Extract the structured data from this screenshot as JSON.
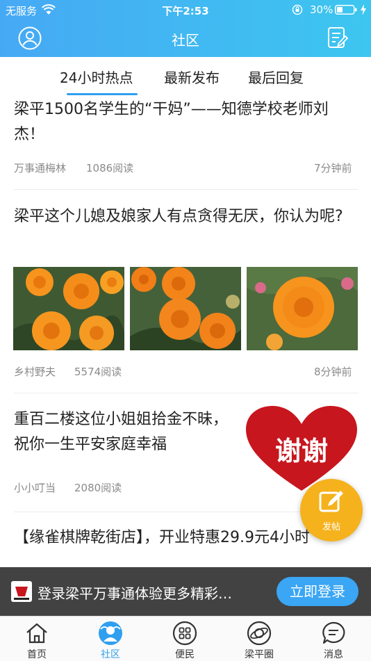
{
  "status_bar": {
    "carrier": "无服务",
    "time": "下午2:53",
    "battery_pct": "30%"
  },
  "nav": {
    "title": "社区"
  },
  "tabs": [
    {
      "label": "24小时热点"
    },
    {
      "label": "最新发布"
    },
    {
      "label": "最后回复"
    }
  ],
  "posts": [
    {
      "title": "梁平1500名学生的“干妈”——知德学校老师刘杰！",
      "author": "万事通梅林",
      "reads": "1086阅读",
      "time": "7分钟前"
    },
    {
      "title": "梁平这个儿媳及娘家人有点贪得无厌，你认为呢?",
      "author": "乡村野夫",
      "reads": "5574阅读",
      "time": "8分钟前"
    },
    {
      "title": "重百二楼这位小姐姐拾金不昧，祝你一生平安家庭幸福",
      "author": "小小叮当",
      "reads": "2080阅读",
      "thumb_text": "谢谢"
    },
    {
      "title": "【缘雀棋牌乾街店】，开业特惠29.9元4小时"
    }
  ],
  "fab": {
    "label": "发帖"
  },
  "banner": {
    "text": "登录梁平万事通体验更多精彩…",
    "button": "立即登录"
  },
  "tabbar": [
    {
      "label": "首页",
      "icon": "home-icon"
    },
    {
      "label": "社区",
      "icon": "community-icon"
    },
    {
      "label": "便民",
      "icon": "grid-icon"
    },
    {
      "label": "梁平圈",
      "icon": "planet-icon"
    },
    {
      "label": "消息",
      "icon": "message-icon"
    }
  ],
  "colors": {
    "accent": "#2f9ff0",
    "fab": "#f5b21c",
    "nav_start": "#46a9f4",
    "nav_end": "#3dc6f0"
  }
}
